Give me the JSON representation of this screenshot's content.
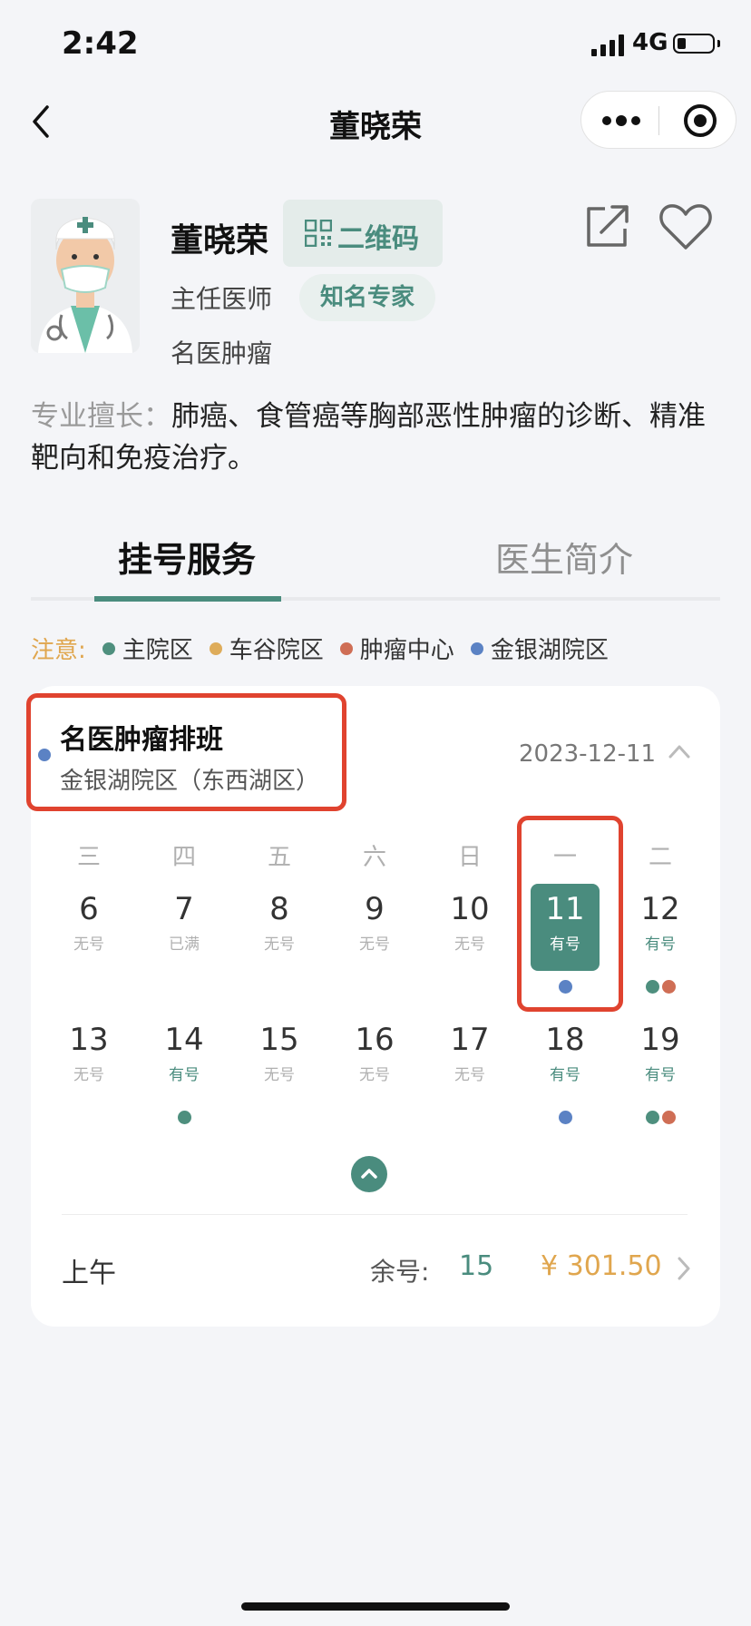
{
  "status_bar": {
    "time": "2:42",
    "network": "4G"
  },
  "nav": {
    "title": "董晓荣"
  },
  "doctor": {
    "name": "董晓荣",
    "qr_label": "二维码",
    "title": "主任医师",
    "badge": "知名专家",
    "department": "名医肿瘤",
    "specialty_label": "专业擅长：",
    "specialty_text": "肺癌、食管癌等胸部恶性肿瘤的诊断、精准靶向和免疫治疗。"
  },
  "tabs": [
    {
      "label": "挂号服务",
      "active": true
    },
    {
      "label": "医生简介",
      "active": false
    }
  ],
  "legend": {
    "note": "注意:",
    "items": [
      {
        "label": "主院区",
        "color": "#4e8f7e"
      },
      {
        "label": "车谷院区",
        "color": "#deac5a"
      },
      {
        "label": "肿瘤中心",
        "color": "#cf6e55"
      },
      {
        "label": "金银湖院区",
        "color": "#5b82c4"
      }
    ]
  },
  "schedule": {
    "title": "名医肿瘤排班",
    "campus": "金银湖院区（东西湖区）",
    "date": "2023-12-11",
    "weekdays": [
      "三",
      "四",
      "五",
      "六",
      "日",
      "一",
      "二"
    ],
    "week1": [
      {
        "num": "6",
        "status": "无号",
        "avail": false,
        "dots": []
      },
      {
        "num": "7",
        "status": "已满",
        "avail": false,
        "dots": []
      },
      {
        "num": "8",
        "status": "无号",
        "avail": false,
        "dots": []
      },
      {
        "num": "9",
        "status": "无号",
        "avail": false,
        "dots": []
      },
      {
        "num": "10",
        "status": "无号",
        "avail": false,
        "dots": []
      },
      {
        "num": "11",
        "status": "有号",
        "avail": true,
        "selected": true,
        "dots": [
          "#5b82c4"
        ]
      },
      {
        "num": "12",
        "status": "有号",
        "avail": true,
        "dots": [
          "#4e8f7e",
          "#cf6e55"
        ]
      }
    ],
    "week2": [
      {
        "num": "13",
        "status": "无号",
        "avail": false,
        "dots": []
      },
      {
        "num": "14",
        "status": "有号",
        "avail": true,
        "dots": [
          "#4e8f7e"
        ]
      },
      {
        "num": "15",
        "status": "无号",
        "avail": false,
        "dots": []
      },
      {
        "num": "16",
        "status": "无号",
        "avail": false,
        "dots": []
      },
      {
        "num": "17",
        "status": "无号",
        "avail": false,
        "dots": []
      },
      {
        "num": "18",
        "status": "有号",
        "avail": true,
        "dots": [
          "#5b82c4"
        ]
      },
      {
        "num": "19",
        "status": "有号",
        "avail": true,
        "dots": [
          "#4e8f7e",
          "#cf6e55"
        ]
      }
    ]
  },
  "slot": {
    "period": "上午",
    "remaining_label": "余号:",
    "remaining": "15",
    "price": "¥ 301.50"
  }
}
